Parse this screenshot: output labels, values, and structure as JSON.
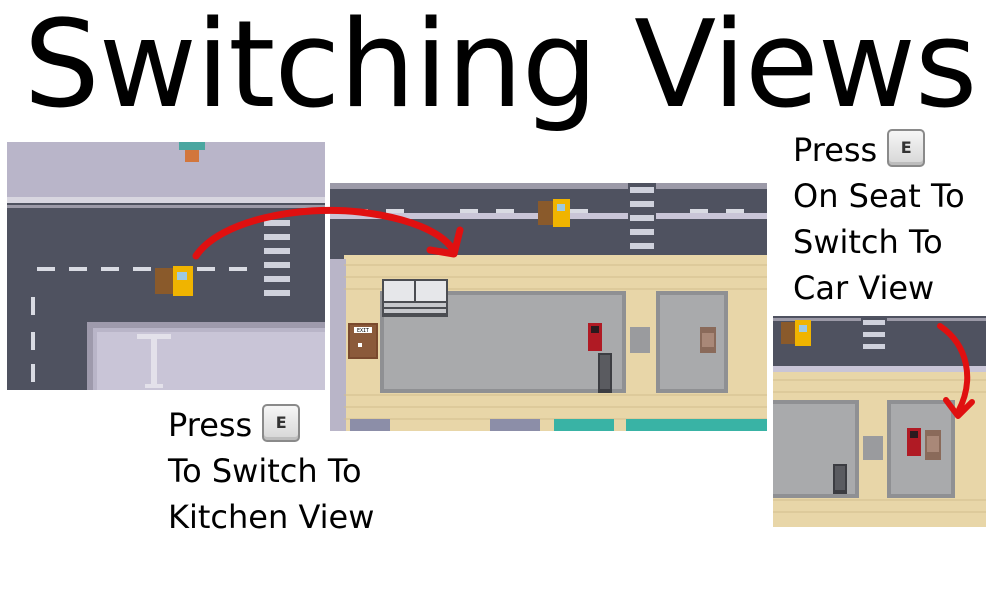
{
  "title": "Switching Views",
  "captions": {
    "kitchen": {
      "press": "Press",
      "key": "E",
      "line2": "To Switch To",
      "line3": "Kitchen View"
    },
    "car": {
      "press": "Press",
      "key": "E",
      "line2": "On Seat To",
      "line3": "Switch To",
      "line4": "Car View"
    }
  },
  "scenes": {
    "street": {
      "description_hidden": ""
    },
    "kitchen": {
      "door_sign": "EXIT"
    }
  },
  "colors": {
    "road": "#4f5260",
    "lane": "#d9dbe3",
    "sidewalk": "#b6b2c6",
    "floor": "#e8d6a8",
    "kitchen_floor": "#a9aaac",
    "arrow": "#e01010",
    "truck": "#f0b400"
  }
}
